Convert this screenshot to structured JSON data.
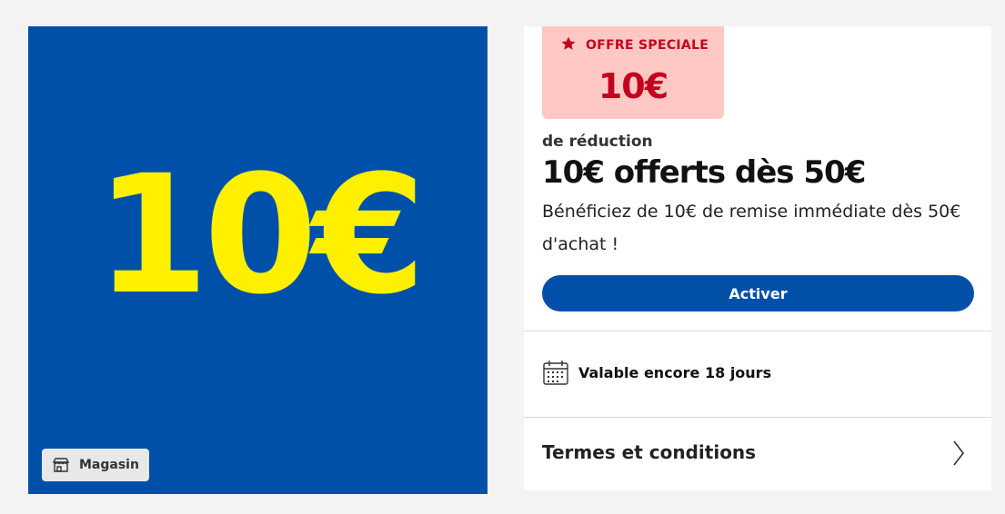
{
  "hero": {
    "amount_text": "10€",
    "tag": {
      "icon": "store-icon",
      "label": "Magasin"
    },
    "colors": {
      "background": "#0050aa",
      "amount": "#fff000"
    }
  },
  "offer": {
    "badge": {
      "icon": "star-icon",
      "label": "OFFRE SPECIALE",
      "value": "10€",
      "colors": {
        "background": "#ffc8c5",
        "text": "#c3001d"
      }
    },
    "subtitle": "de réduction",
    "title": "10€ offerts dès 50€",
    "description": "Bénéficiez de 10€ de remise immédiate dès 50€ d'achat !",
    "activate_label": "Activer",
    "validity": {
      "icon": "calendar-icon",
      "text": "Valable encore 18 jours"
    },
    "terms": {
      "label": "Termes et conditions",
      "icon": "chevron-right-icon"
    },
    "colors": {
      "accent": "#0050aa"
    }
  }
}
